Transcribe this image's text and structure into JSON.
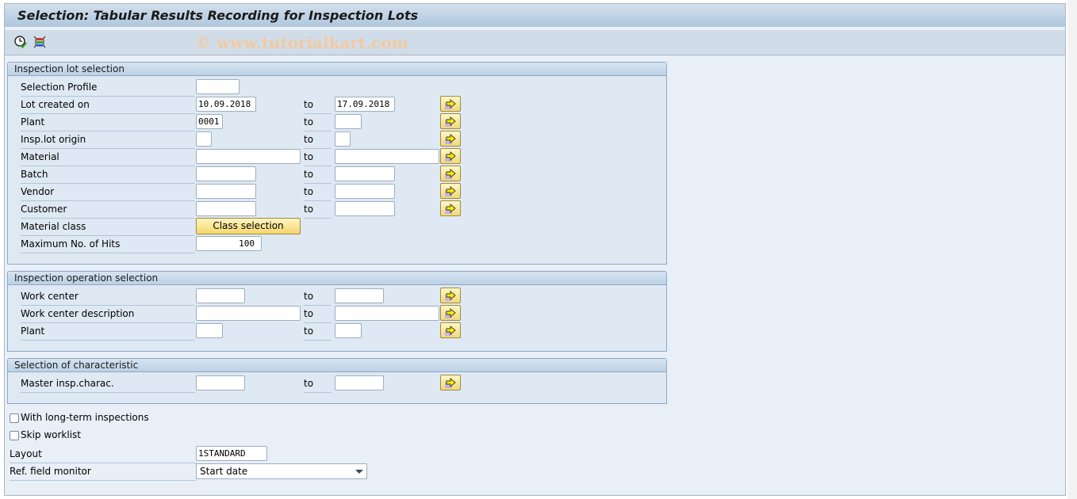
{
  "window": {
    "title": "Selection: Tabular Results Recording for Inspection Lots",
    "watermark": "© www.tutorialkart.com"
  },
  "toolbar": {
    "icons": [
      "execute-clock-check-icon",
      "layout-columns-icon"
    ]
  },
  "groups": [
    {
      "title": "Inspection lot selection",
      "fields": [
        {
          "label": "Selection Profile",
          "from": ""
        },
        {
          "label": "Lot created on",
          "from": "10.09.2018",
          "to_label": "to",
          "to": "17.09.2018"
        },
        {
          "label": "Plant",
          "from": "0001",
          "to_label": "to",
          "to": ""
        },
        {
          "label": "Insp.lot origin",
          "from": "",
          "to_label": "to",
          "to": ""
        },
        {
          "label": "Material",
          "from": "",
          "to_label": "to",
          "to": ""
        },
        {
          "label": "Batch",
          "from": "",
          "to_label": "to",
          "to": ""
        },
        {
          "label": "Vendor",
          "from": "",
          "to_label": "to",
          "to": ""
        },
        {
          "label": "Customer",
          "from": "",
          "to_label": "to",
          "to": ""
        },
        {
          "label": "Material class",
          "button": "Class selection"
        },
        {
          "label": "Maximum No. of Hits",
          "from": "100"
        }
      ]
    },
    {
      "title": "Inspection operation selection",
      "fields": [
        {
          "label": "Work center",
          "from": "",
          "to_label": "to",
          "to": ""
        },
        {
          "label": "Work center description",
          "from": "",
          "to_label": "to",
          "to": ""
        },
        {
          "label": "Plant",
          "from": "",
          "to_label": "to",
          "to": ""
        }
      ]
    },
    {
      "title": "Selection of characteristic",
      "fields": [
        {
          "label": "Master insp.charac.",
          "from": "",
          "to_label": "to",
          "to": ""
        }
      ]
    }
  ],
  "options": {
    "long_term": {
      "label": "With long-term inspections",
      "checked": false
    },
    "skip_worklist": {
      "label": "Skip worklist",
      "checked": false
    },
    "layout": {
      "label": "Layout",
      "value": "1STANDARD"
    },
    "ref_field": {
      "label": "Ref. field monitor",
      "value": "Start date"
    }
  }
}
